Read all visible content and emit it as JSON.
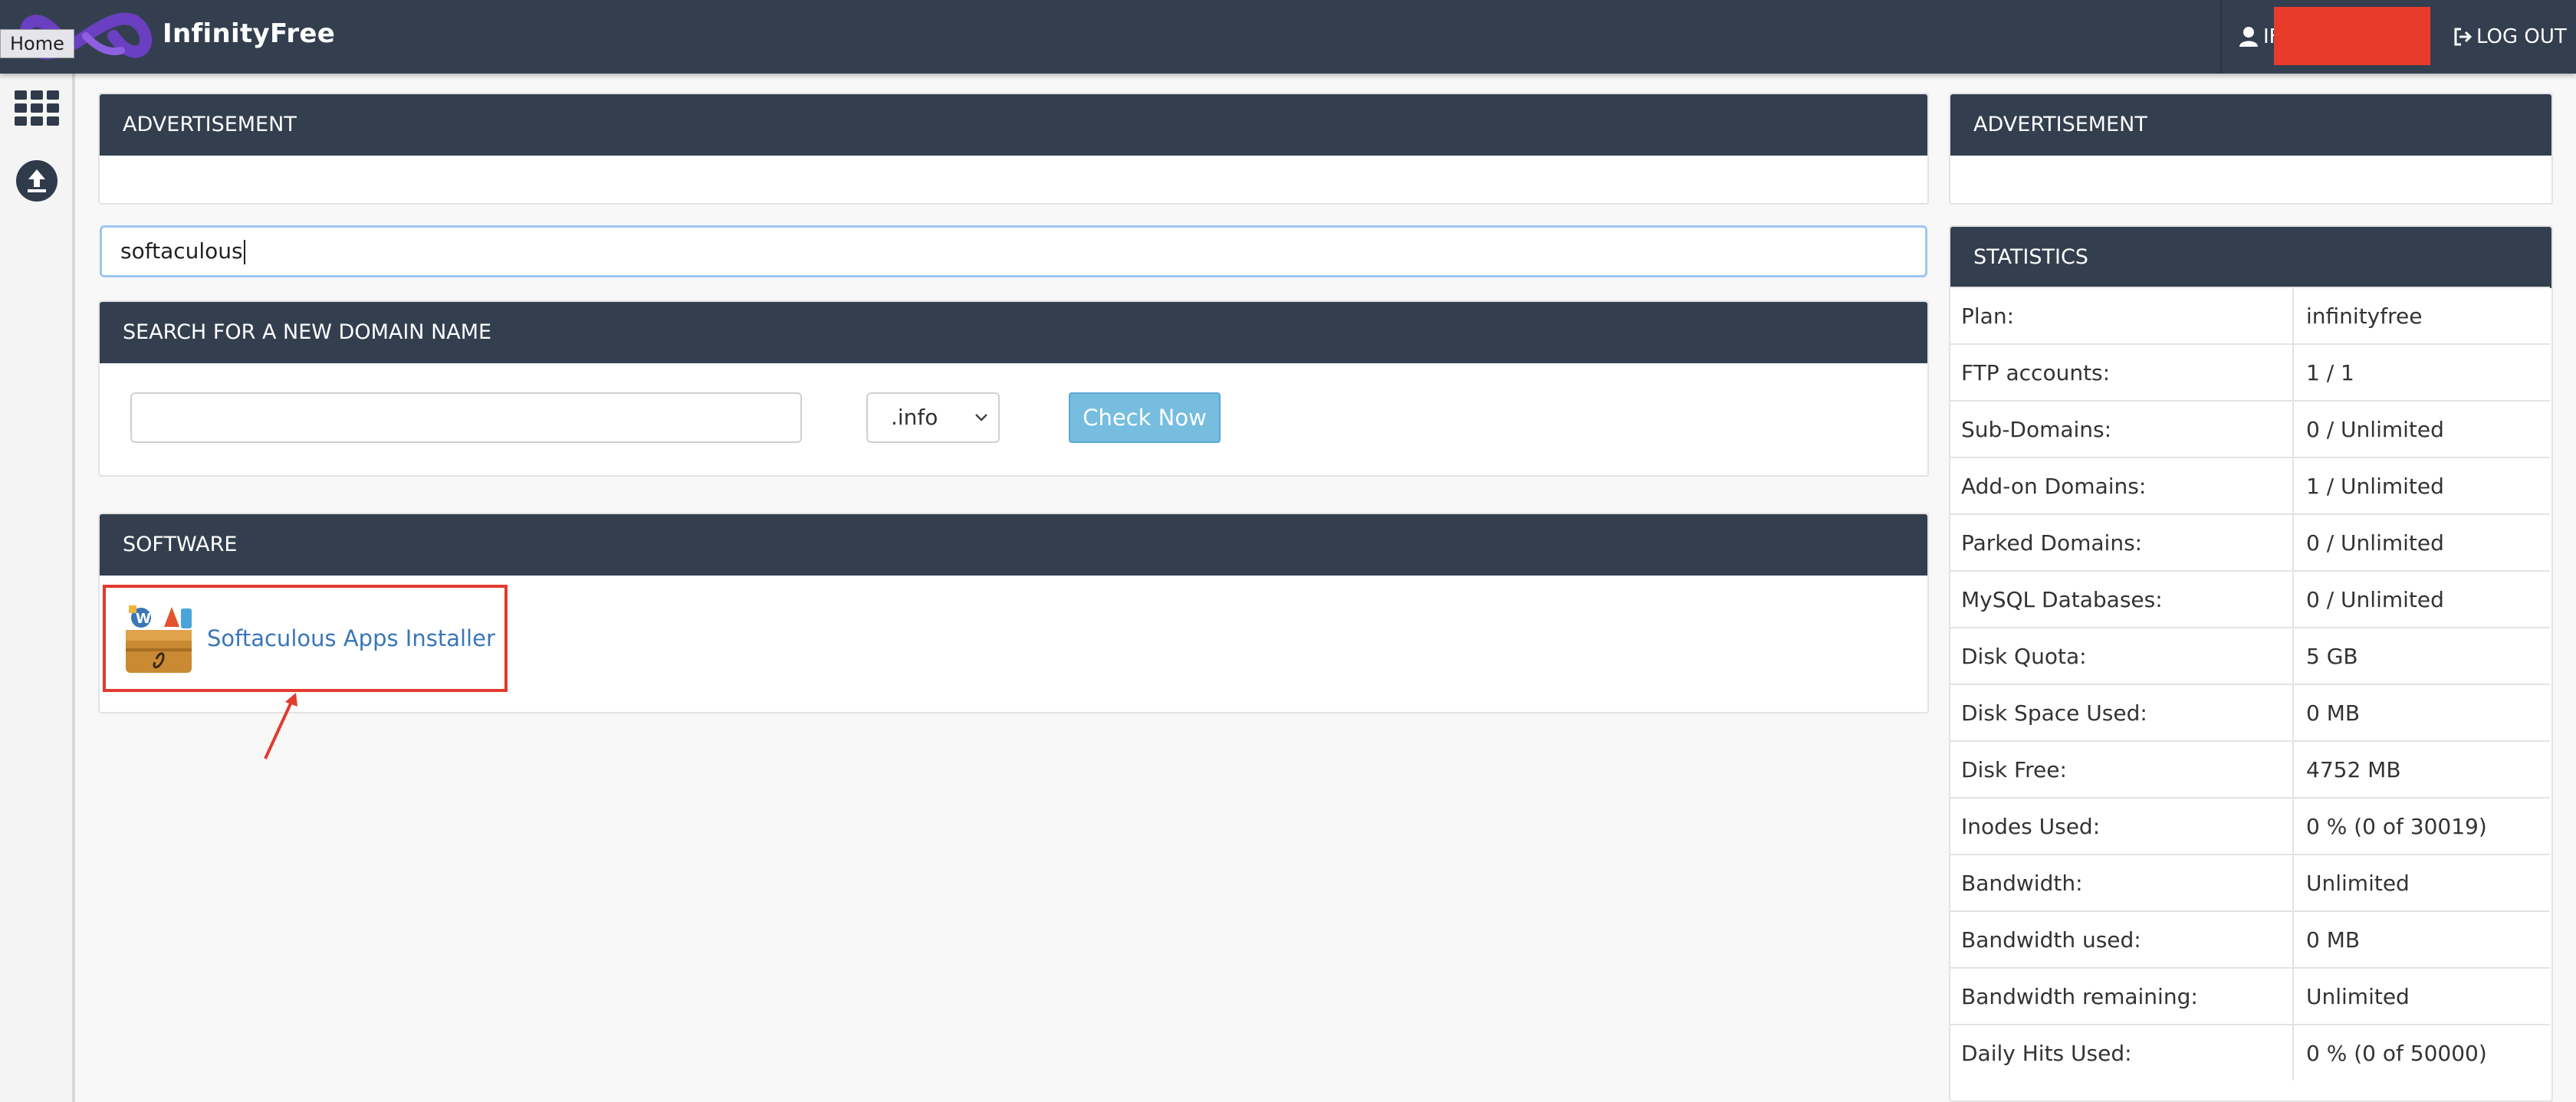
{
  "header": {
    "brand": "InfinityFree",
    "home_tooltip": "Home",
    "user_initial": "IF",
    "logout_label": "LOG OUT"
  },
  "left_panel": {
    "advertisement_title": "ADVERTISEMENT",
    "search_value": "softaculous",
    "domain_search": {
      "title": "SEARCH FOR A NEW DOMAIN NAME",
      "input_value": "",
      "tld_selected": ".info",
      "button_label": "Check Now"
    },
    "software": {
      "title": "SOFTWARE",
      "item_label": "Softaculous Apps Installer"
    }
  },
  "right_panel": {
    "advertisement_title": "ADVERTISEMENT",
    "statistics_title": "STATISTICS",
    "rows": [
      {
        "label": "Plan:",
        "value": "infinityfree"
      },
      {
        "label": "FTP accounts:",
        "value": "1 / 1"
      },
      {
        "label": "Sub-Domains:",
        "value": "0 / Unlimited"
      },
      {
        "label": "Add-on Domains:",
        "value": "1 / Unlimited"
      },
      {
        "label": "Parked Domains:",
        "value": "0 / Unlimited"
      },
      {
        "label": "MySQL Databases:",
        "value": "0 / Unlimited"
      },
      {
        "label": "Disk Quota:",
        "value": "5 GB"
      },
      {
        "label": "Disk Space Used:",
        "value": "0 MB"
      },
      {
        "label": "Disk Free:",
        "value": "4752 MB"
      },
      {
        "label": "Inodes Used:",
        "value": "0 % (0 of 30019)"
      },
      {
        "label": "Bandwidth:",
        "value": "Unlimited"
      },
      {
        "label": "Bandwidth used:",
        "value": "0 MB"
      },
      {
        "label": "Bandwidth remaining:",
        "value": "Unlimited"
      },
      {
        "label": "Daily Hits Used:",
        "value": "0 % (0 of 50000)"
      }
    ]
  },
  "colors": {
    "navbar": "#333f4f",
    "accent_button": "#76bddf",
    "link": "#3a76b8",
    "highlight_box": "#e23b2d",
    "redaction": "#e93b2c",
    "logo_purple": "#6a3fc1"
  },
  "icons": [
    "infinity-logo-icon",
    "user-icon",
    "logout-icon",
    "apps-grid-icon",
    "upload-icon",
    "chevron-down-icon",
    "softaculous-icon",
    "annotation-arrow-icon"
  ]
}
